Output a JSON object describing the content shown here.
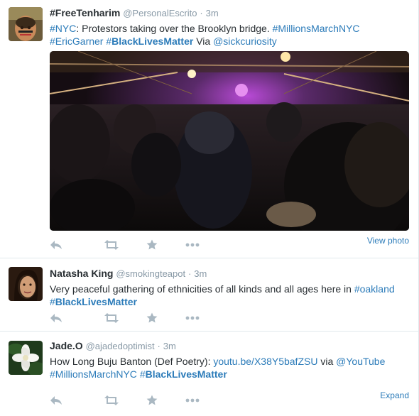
{
  "tweets": [
    {
      "fullname": "#FreeTenharim",
      "username": "@PersonalEscrito",
      "separator": "·",
      "time": "3m",
      "text_parts": {
        "p1": "#NYC",
        "p2": ": Protestors taking over the Brooklyn bridge. ",
        "p3": "#MillionsMarchNYC",
        "p4": "#EricGarner",
        "p5": "#",
        "p6": "BlackLivesMatter",
        "p7": " Via ",
        "p8": "@sickcuriosity"
      },
      "media_alt": "Crowd of protestors on the Brooklyn Bridge at night",
      "action_link": "View photo"
    },
    {
      "fullname": "Natasha King",
      "username": "@smokingteapot",
      "separator": "·",
      "time": "3m",
      "text_parts": {
        "p1": "Very peaceful gathering of ethnicities of all kinds and all ages here in ",
        "p2": "#oakland",
        "p3": "#",
        "p4": "BlackLivesMatter"
      }
    },
    {
      "fullname": "Jade.O",
      "username": "@ajadedoptimist",
      "separator": "·",
      "time": "3m",
      "text_parts": {
        "p1": "How Long Buju Banton (Def Poetry): ",
        "p2": "youtu.be/X38Y5bafZSU",
        "p3": " via ",
        "p4": "@YouTube",
        "p5": "#MillionsMarchNYC",
        "p6": "#",
        "p7": "BlackLivesMatter"
      },
      "action_link": "Expand"
    }
  ],
  "icons": {
    "reply": "reply-icon",
    "retweet": "retweet-icon",
    "favorite": "star-icon",
    "more": "more-icon"
  },
  "colors": {
    "link": "#2b7bb9",
    "muted": "#8899a6",
    "icon": "#aab8c2",
    "divider": "#e1e8ed"
  }
}
